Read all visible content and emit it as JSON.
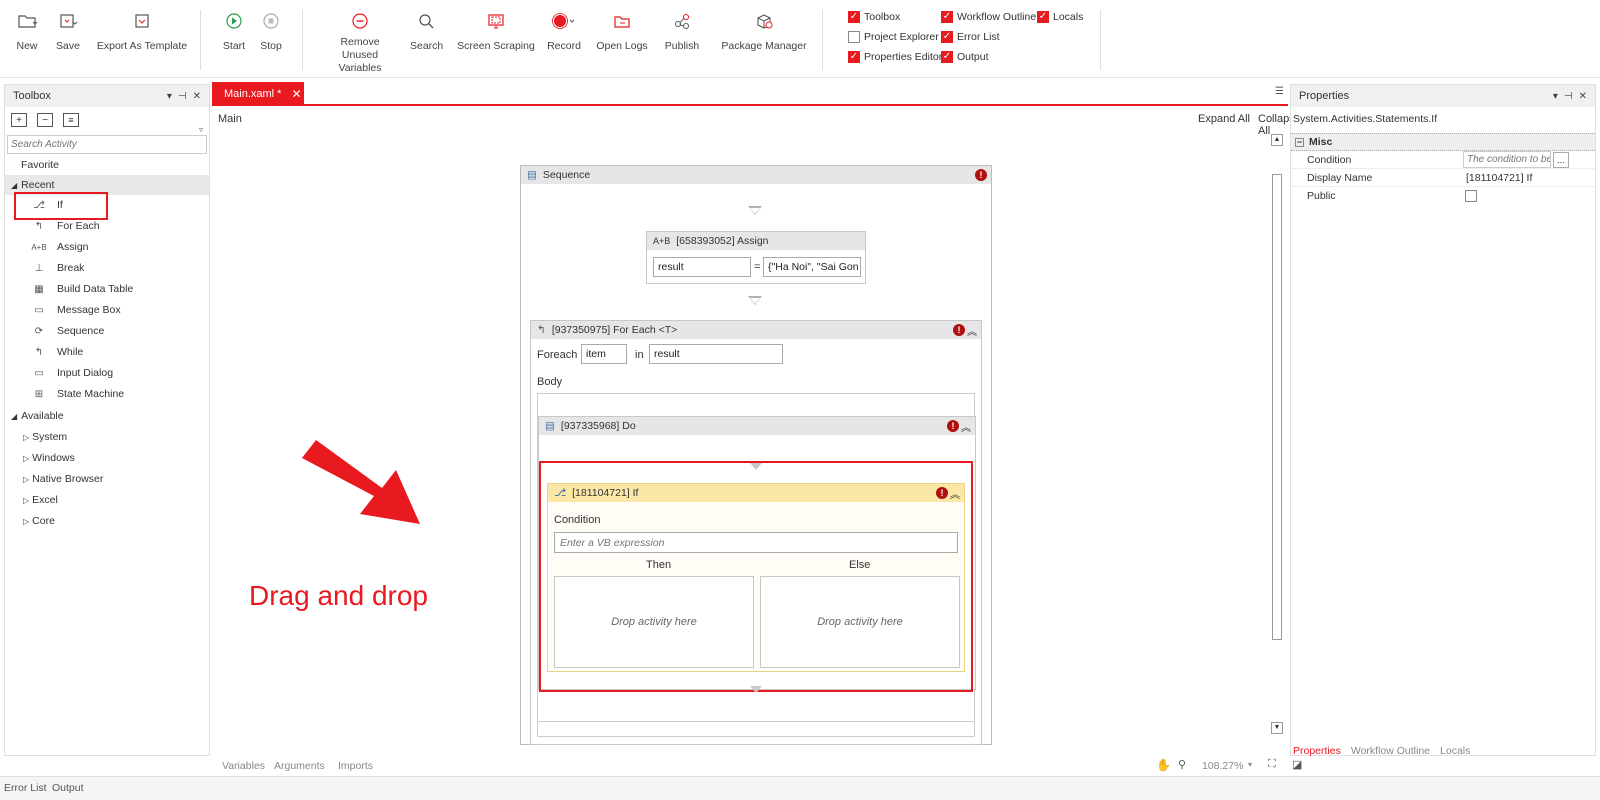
{
  "ribbon": {
    "buttons": {
      "new": "New",
      "save": "Save",
      "export": "Export As Template",
      "start": "Start",
      "stop": "Stop",
      "remove_unused_1": "Remove Unused",
      "remove_unused_2": "Variables",
      "search": "Search",
      "screen_scraping": "Screen Scraping",
      "record": "Record",
      "open_logs": "Open Logs",
      "publish": "Publish",
      "package_manager": "Package Manager"
    },
    "panels": {
      "toolbox": "Toolbox",
      "workflow_outline": "Workflow Outline",
      "locals": "Locals",
      "project_explorer": "Project Explorer",
      "error_list": "Error List",
      "properties_editor": "Properties Editor",
      "output": "Output"
    },
    "accent": "#e8191f"
  },
  "toolbox": {
    "title": "Toolbox",
    "search_placeholder": "Search Activity",
    "favorite": "Favorite",
    "recent": "Recent",
    "recent_items": [
      "If",
      "For Each",
      "Assign",
      "Break",
      "Build Data Table",
      "Message Box",
      "Sequence",
      "While",
      "Input Dialog",
      "State Machine"
    ],
    "available": "Available",
    "available_items": [
      "System",
      "Windows",
      "Native Browser",
      "Excel",
      "Core"
    ]
  },
  "tabs": {
    "main_file": "Main.xaml *"
  },
  "designer": {
    "breadcrumb": "Main",
    "expand_all": "Expand All",
    "collapse_all": "Collapse All",
    "sequence_title": "Sequence",
    "assign": {
      "title": "[658393052] Assign",
      "left": "result",
      "eq": "=",
      "right": "{\"Ha Noi\", \"Sai Gon"
    },
    "foreach": {
      "title": "[937350975] For Each <T>",
      "foreach_label": "Foreach",
      "item": "item",
      "in_label": "in",
      "collection": "result",
      "body_label": "Body"
    },
    "do_title": "[937335968] Do",
    "if": {
      "title": "[181104721] If",
      "condition_label": "Condition",
      "condition_placeholder": "Enter a VB expression",
      "then_label": "Then",
      "else_label": "Else",
      "then_drop": "Drop activity here",
      "else_drop": "Drop activity here"
    },
    "annotation": "Drag and drop",
    "bottom_tabs": [
      "Variables",
      "Arguments",
      "Imports"
    ],
    "zoom": "108.27%"
  },
  "properties": {
    "title": "Properties",
    "type": "System.Activities.Statements.If",
    "category": "Misc",
    "rows": [
      {
        "name": "Condition",
        "value": "The condition to be"
      },
      {
        "name": "Display Name",
        "value": "[181104721] If"
      },
      {
        "name": "Public",
        "value": ""
      }
    ],
    "ellipsis": "...",
    "bottom_tabs": [
      "Properties",
      "Workflow Outline",
      "Locals"
    ]
  },
  "statusbar": {
    "items": [
      "Error List",
      "Output"
    ]
  }
}
